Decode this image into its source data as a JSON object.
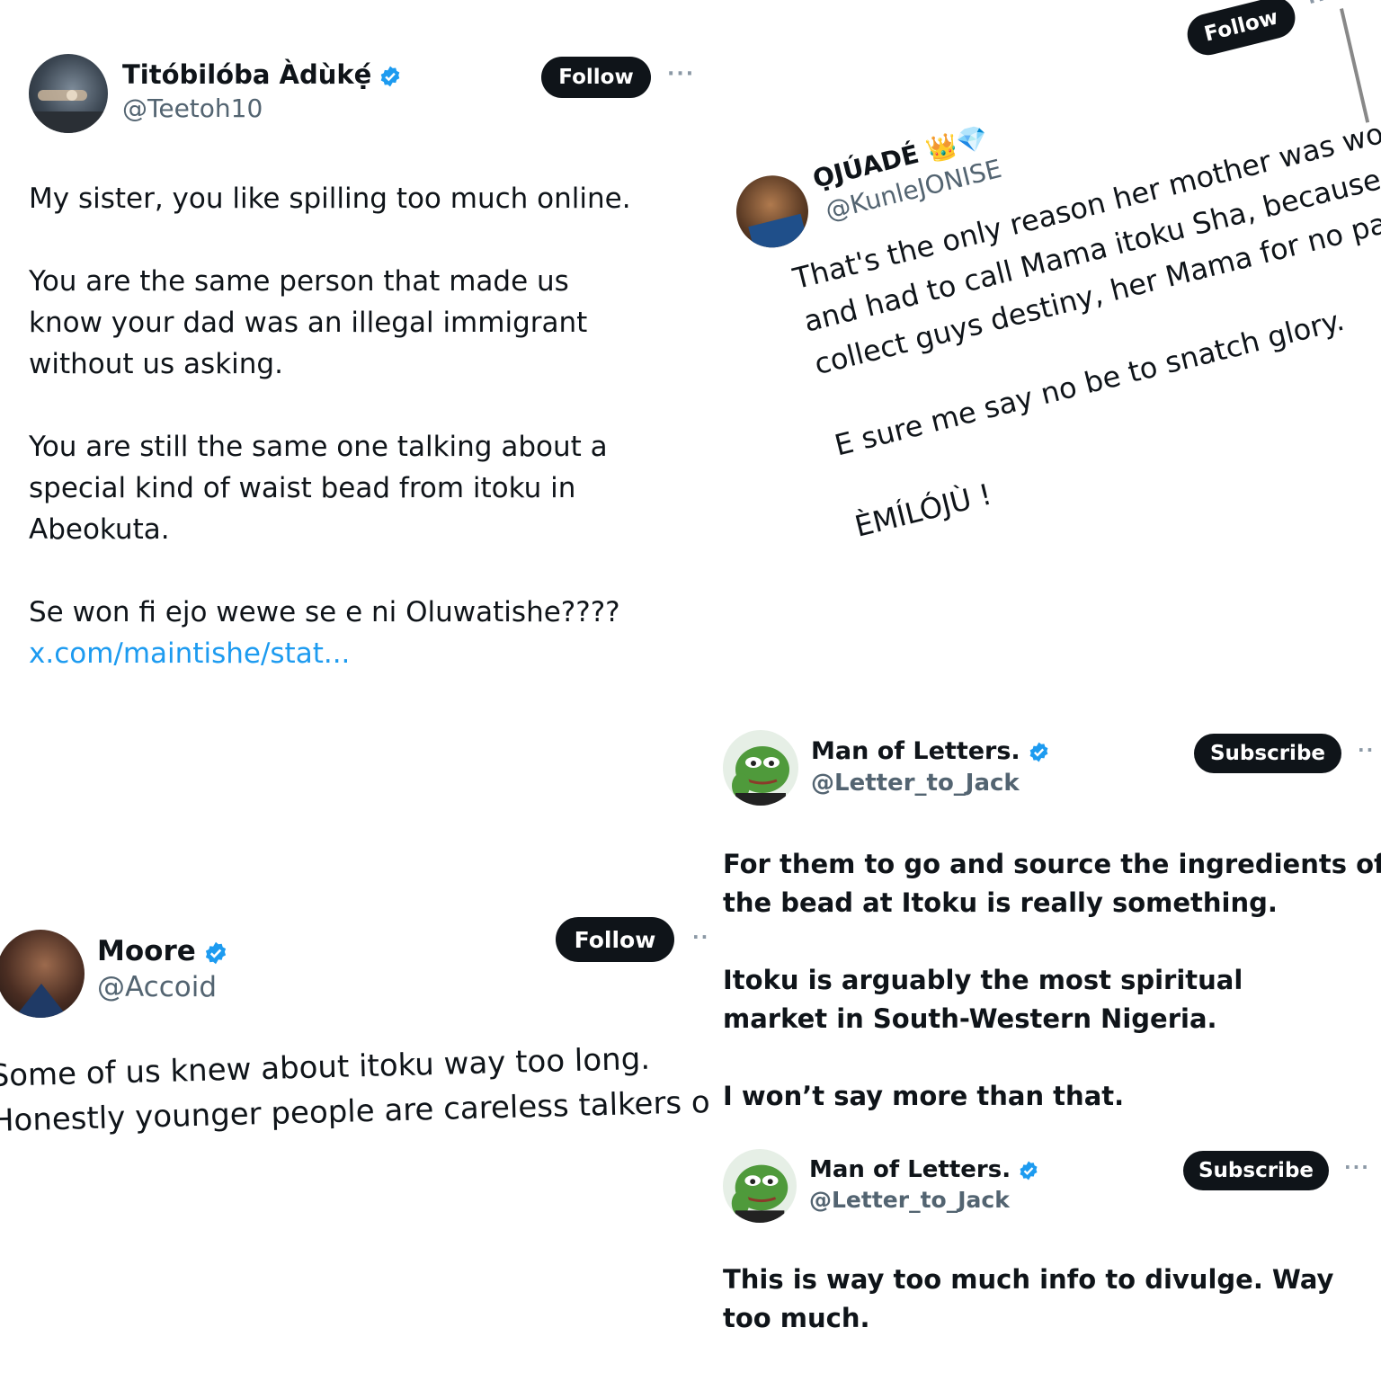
{
  "colors": {
    "accent": "#1d9bf0",
    "button_bg": "#0f1419",
    "handle_gray": "#536471"
  },
  "tweet1": {
    "name": "Titóbilóba Àdùkẹ́",
    "handle": "@Teetoh10",
    "verified": true,
    "follow_label": "Follow",
    "more_label": "···",
    "paragraphs": [
      "My sister, you like spilling too much online.",
      "You are the same person that made us know your dad was an illegal immigrant without us asking.",
      "You are still the same one talking about a special kind of waist bead from itoku in Abeokuta.",
      "Se won fi ejo wewe se e ni Oluwatishe????"
    ],
    "link": "x.com/maintishe/stat..."
  },
  "tweet2": {
    "name": "ỌJÚADÉ 👑💎",
    "handle": "@KunleJONISE",
    "follow_label": "Follow",
    "more_label": "···",
    "lines": [
      "That's the only reason her mother was worried",
      "and had to call Mama itoku Sha, because if na to",
      "collect guys destiny, her Mama for no panick."
    ],
    "line2": "E sure me say no be to snatch glory.",
    "line3": "ÈMÍLÓJÙ !"
  },
  "tweet3": {
    "name": "Man of Letters.",
    "handle": "@Letter_to_Jack",
    "verified": true,
    "subscribe_label": "Subscribe",
    "more_label": "··",
    "paragraphs": [
      "For them to go and source the ingredients of the bead at Itoku is really something.",
      "Itoku is arguably the most spiritual market in South-Western Nigeria.",
      "I won’t say more than that."
    ]
  },
  "tweet4": {
    "name": "Moore",
    "handle": "@Accoid",
    "verified": true,
    "follow_label": "Follow",
    "more_label": "··",
    "lines": [
      "Some of us knew about itoku way too long.",
      "Honestly younger people are careless talkers o."
    ]
  },
  "tweet5": {
    "name": "Man of Letters.",
    "handle": "@Letter_to_Jack",
    "verified": true,
    "subscribe_label": "Subscribe",
    "more_label": "···",
    "paragraphs": [
      "This is way too much info to divulge. Way too much."
    ]
  }
}
